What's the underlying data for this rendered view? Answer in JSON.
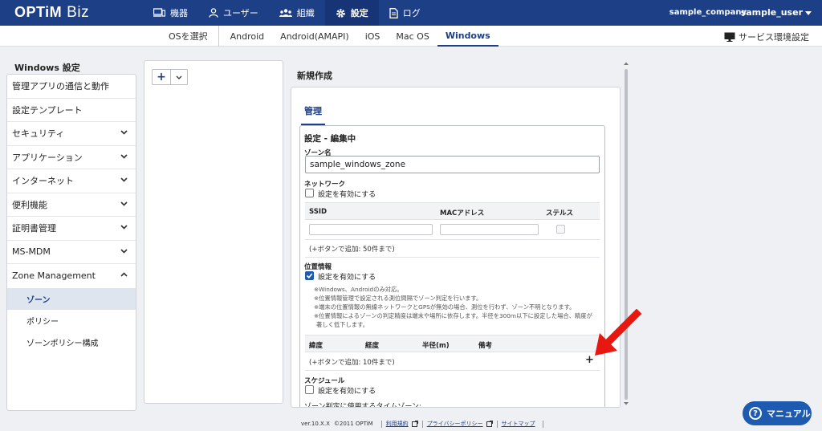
{
  "brand": {
    "name": "OPTiM",
    "product": "Biz"
  },
  "topnav": [
    {
      "label": "機器",
      "icon": "device-icon",
      "active": false
    },
    {
      "label": "ユーザー",
      "icon": "user-icon",
      "active": false
    },
    {
      "label": "組織",
      "icon": "group-icon",
      "active": false
    },
    {
      "label": "設定",
      "icon": "gear-icon",
      "active": true
    },
    {
      "label": "ログ",
      "icon": "document-icon",
      "active": false
    }
  ],
  "account": {
    "company": "sample_company",
    "user": "sample_user"
  },
  "os_tabs": [
    {
      "label": "OSを選択"
    },
    {
      "label": "Android"
    },
    {
      "label": "Android(AMAPI)"
    },
    {
      "label": "iOS"
    },
    {
      "label": "Mac OS"
    },
    {
      "label": "Windows",
      "active": true
    }
  ],
  "service_settings": "サービス環境設定",
  "sidebar": {
    "title": "Windows 設定",
    "items": [
      {
        "label": "管理アプリの通信と動作"
      },
      {
        "label": "設定テンプレート"
      },
      {
        "label": "セキュリティ"
      },
      {
        "label": "アプリケーション"
      },
      {
        "label": "インターネット"
      },
      {
        "label": "便利機能"
      },
      {
        "label": "証明書管理"
      },
      {
        "label": "MS-MDM"
      },
      {
        "label": "Zone Management"
      }
    ],
    "subitems": [
      {
        "label": "ゾーン",
        "active": true
      },
      {
        "label": "ポリシー"
      },
      {
        "label": "ゾーンポリシー構成"
      }
    ]
  },
  "main": {
    "title": "新規作成",
    "tab": "管理",
    "edit_title": "設定 - 編集中",
    "zone_name_label": "ゾーン名",
    "zone_name_value": "sample_windows_zone",
    "network_label": "ネットワーク",
    "enable_label": "設定を有効にする",
    "network_columns": [
      "SSID",
      "MACアドレス",
      "ステルス"
    ],
    "network_hint": "(+ボタンで追加: 50件まで)",
    "location_label": "位置情報",
    "location_enable_label": "設定を有効にする",
    "location_notes": [
      "※Windows、Androidのみ対応。",
      "※位置情報管理で設定される測位間隔でゾーン判定を行います。",
      "※端末の位置情報の無線ネットワークとGPSが無効の場合、測位を行わず、ゾーン不明となります。",
      "※位置情報によるゾーンの判定精度は端末や場所に依存します。半径を300m以下に設定した場合、精度が",
      "著しく低下します。"
    ],
    "location_columns": [
      "緯度",
      "経度",
      "半径(m)",
      "備考"
    ],
    "location_hint": "(+ボタンで追加: 10件まで)",
    "schedule_label": "スケジュール",
    "schedule_enable_label": "設定を有効にする",
    "timezone_label": "ゾーン判定に使用するタイムゾーン:"
  },
  "footer": {
    "version": "ver.10.X.X",
    "copyright": "©2011 OPTiM",
    "terms": "利用規約",
    "privacy": "プライバシーポリシー",
    "sitemap": "サイトマップ"
  },
  "manual_button": "マニュアル",
  "colors": {
    "header": "#1d3f86",
    "accent": "#1d5ab0",
    "arrow": "#e8170f"
  }
}
